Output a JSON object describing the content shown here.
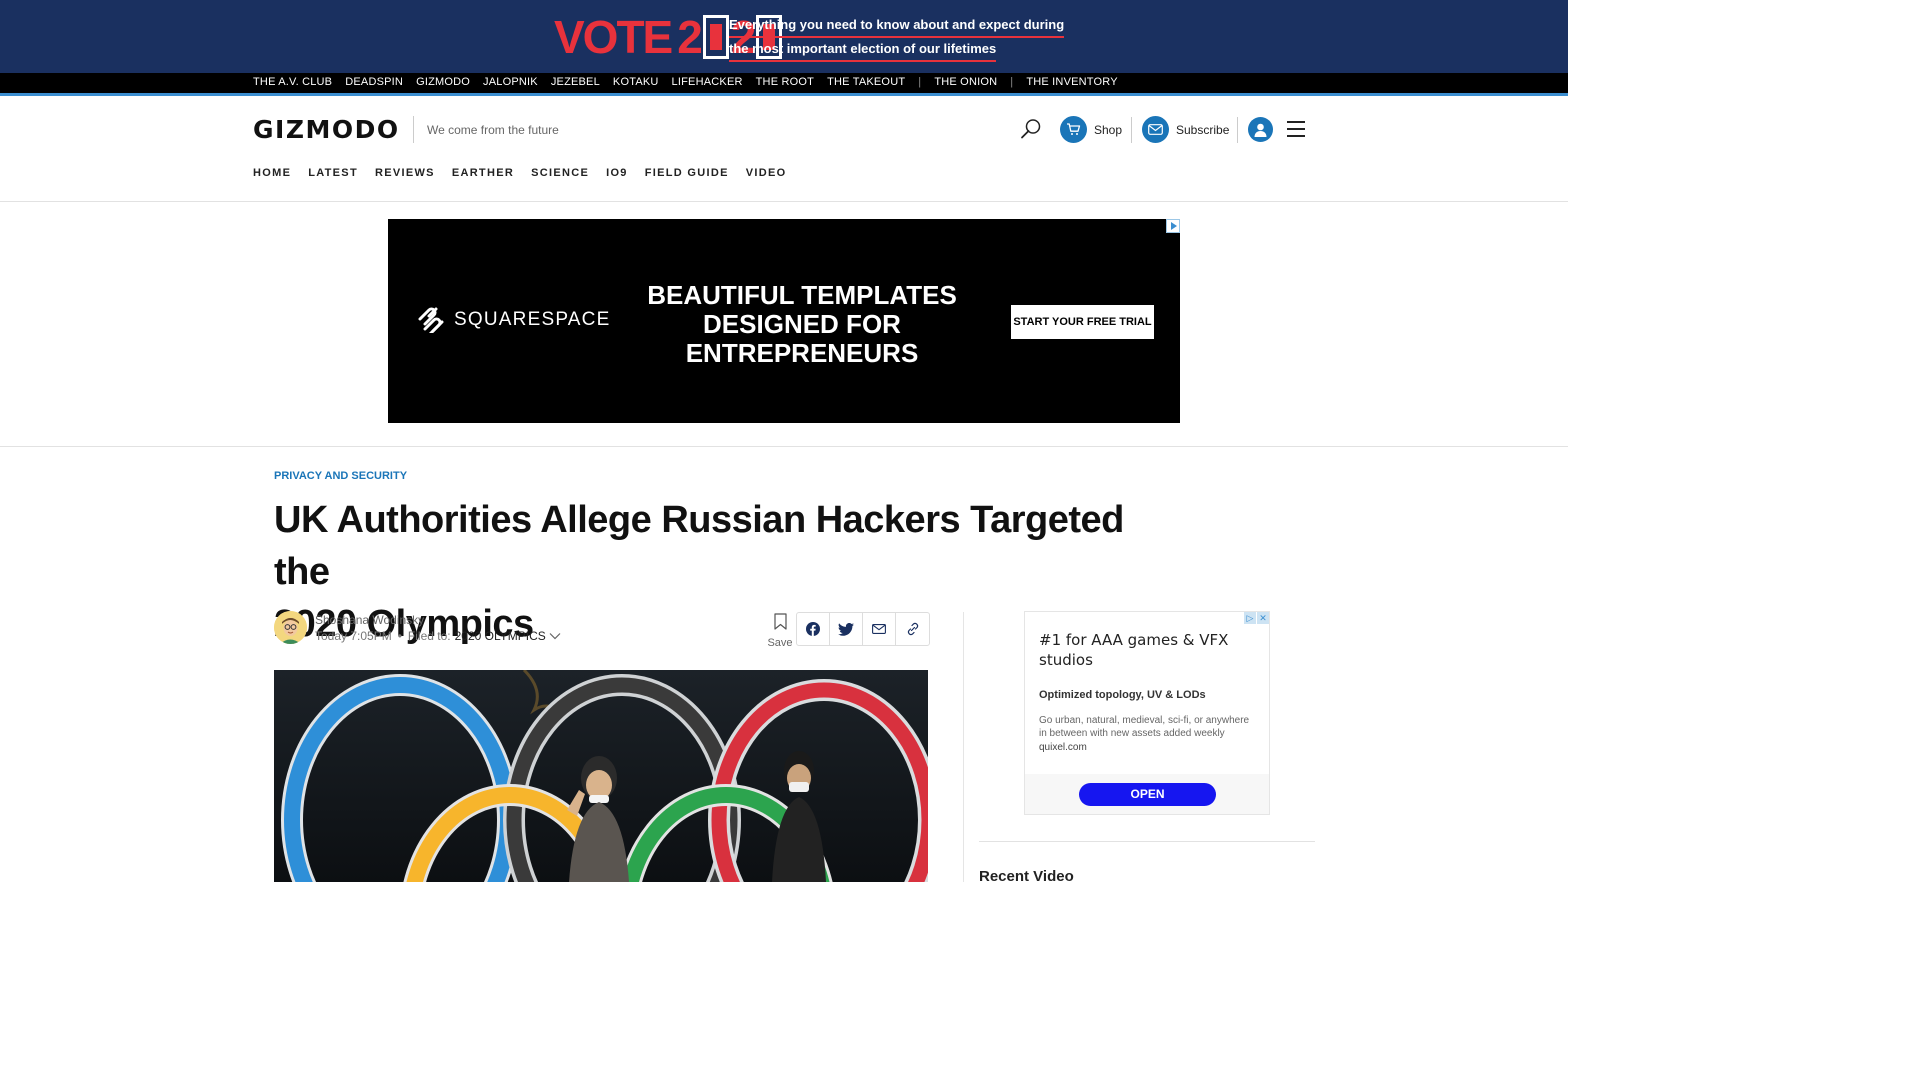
{
  "election_banner": {
    "logo_vote": "VOTE",
    "logo_year_parts": [
      "2",
      "2"
    ],
    "line1": "Everything you need to know about and expect during",
    "line2": "the most important election of our lifetimes"
  },
  "network": {
    "sites": [
      "THE A.V. CLUB",
      "DEADSPIN",
      "GIZMODO",
      "JALOPNIK",
      "JEZEBEL",
      "KOTAKU",
      "LIFEHACKER",
      "THE ROOT",
      "THE TAKEOUT"
    ],
    "extra_1": "THE ONION",
    "extra_2": "THE INVENTORY",
    "separator": "|"
  },
  "header": {
    "logo": "GIZMODO",
    "tagline": "We come from the future",
    "shop_label": "Shop",
    "subscribe_label": "Subscribe"
  },
  "nav": {
    "items": [
      "HOME",
      "LATEST",
      "REVIEWS",
      "EARTHER",
      "SCIENCE",
      "IO9",
      "FIELD GUIDE",
      "VIDEO"
    ]
  },
  "ad": {
    "brand": "SQUARESPACE",
    "headline_1": "BEAUTIFUL TEMPLATES",
    "headline_2": "DESIGNED FOR",
    "headline_3": "ENTREPRENEURS",
    "cta": "START YOUR FREE TRIAL"
  },
  "article": {
    "category": "PRIVACY AND SECURITY",
    "headline_1": "UK Authorities Allege Russian Hackers Targeted the",
    "headline_2": "2020 Olympics",
    "author": "Shoshana Wodinsky",
    "timestamp": "Today 7:05PM",
    "dot": "•",
    "filed_label": "Filed to:",
    "filed_tag": "2020 OLYMPICS",
    "save_label": "Save"
  },
  "sidebar_ad": {
    "title": "#1 for AAA games & VFX studios",
    "subtitle": "Optimized topology, UV & LODs",
    "description": "Go urban, natural, medieval, sci-fi, or anywhere in between with new assets added weekly",
    "domain": "quixel.com",
    "button": "OPEN"
  },
  "sidebar": {
    "recent_video": "Recent Video"
  },
  "colors": {
    "banner_bg": "#1a3060",
    "vote_red": "#e8323c",
    "accent_blue": "#1a75b8",
    "open_button": "#1616f0"
  },
  "icons": [
    "search-icon",
    "cart-icon",
    "mail-icon",
    "user-icon",
    "hamburger-icon",
    "bookmark-icon",
    "facebook-icon",
    "twitter-icon",
    "email-icon",
    "link-icon",
    "chevron-down-icon",
    "ad-choices-icon",
    "close-icon"
  ]
}
